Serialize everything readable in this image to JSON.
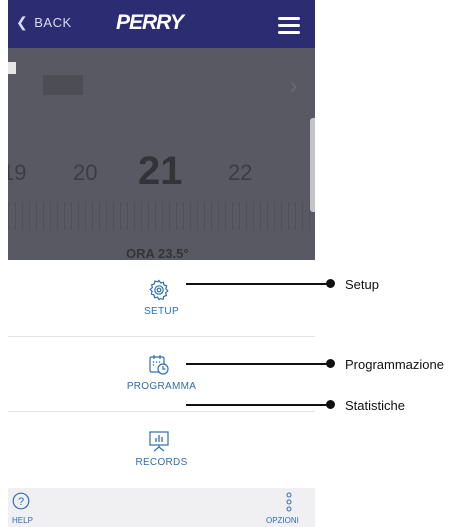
{
  "header": {
    "back_label": "BACK",
    "logo_text": "PERRY",
    "menu_icon": "hamburger-menu-icon"
  },
  "thermostat": {
    "temps": [
      "19",
      "20",
      "21",
      "22"
    ],
    "selected": "21",
    "ora_label": "ORA 23.5°"
  },
  "menu": {
    "items": [
      {
        "label": "SETUP",
        "icon": "gear-icon"
      },
      {
        "label": "PROGRAMMA",
        "icon": "calendar-clock-icon"
      },
      {
        "label": "RECORDS",
        "icon": "chart-board-icon"
      }
    ]
  },
  "bottom_bar": {
    "help_label": "HELP",
    "options_label": "OPZIONI"
  },
  "callouts": [
    "Setup",
    "Programmazione",
    "Statistiche"
  ],
  "colors": {
    "header": "#2b2c72",
    "accent": "#2f6db3",
    "overlay": "#585962"
  }
}
